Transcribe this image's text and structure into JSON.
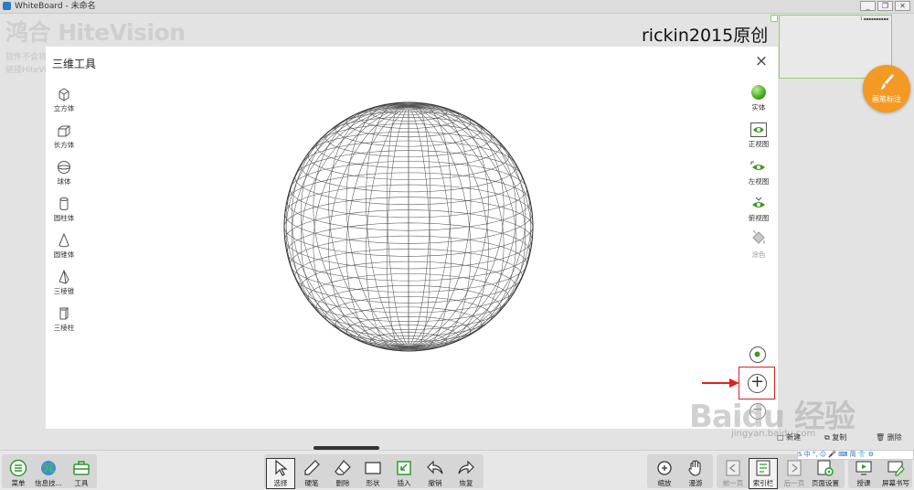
{
  "window": {
    "app_name": "WhiteBoard",
    "title": "WhiteBoard - 未命名",
    "buttons": [
      "_",
      "❐",
      "✕"
    ]
  },
  "brand": {
    "logo_text": "鸿合 HiteVision",
    "lines": [
      "软件不会将",
      "链接HiteVi"
    ]
  },
  "watermark_text": "rickin2015原创",
  "thumbnail": {
    "label": "1 ▪▪▪▪▪▪▪▪▪▪"
  },
  "pen_button": {
    "label": "画笔标注"
  },
  "dialog": {
    "title": "三维工具",
    "close": "×",
    "shapes": [
      {
        "label": "立方体",
        "icon": "cube-icon"
      },
      {
        "label": "长方体",
        "icon": "cuboid-icon"
      },
      {
        "label": "球体",
        "icon": "sphere-icon"
      },
      {
        "label": "圆柱体",
        "icon": "cylinder-icon"
      },
      {
        "label": "圆锥体",
        "icon": "cone-icon"
      },
      {
        "label": "三棱锥",
        "icon": "triangular-pyramid-icon"
      },
      {
        "label": "三棱柱",
        "icon": "triangular-prism-icon"
      }
    ],
    "views": [
      {
        "label": "实体",
        "icon": "solid-ball-icon",
        "enabled": true
      },
      {
        "label": "正视图",
        "icon": "front-view-eye-icon",
        "enabled": true
      },
      {
        "label": "左视图",
        "icon": "left-view-eye-icon",
        "enabled": true
      },
      {
        "label": "俯视图",
        "icon": "top-view-eye-icon",
        "enabled": true
      },
      {
        "label": "涂色",
        "icon": "paint-bucket-icon",
        "enabled": false
      }
    ],
    "zoom_plus": "+",
    "zoom_minus": "−"
  },
  "page_tools": [
    {
      "label": "新建",
      "icon": "new-page-icon"
    },
    {
      "label": "复制",
      "icon": "copy-page-icon"
    },
    {
      "label": "删除",
      "icon": "trash-icon"
    }
  ],
  "watermark": {
    "main": "Baidu 经验",
    "sub": "jingyan.baidu.com"
  },
  "ime_bar": "S 中 °,  ☺ 🎤 ⌨ 简 👕 ⚙",
  "toolbar": {
    "left": [
      {
        "label": "菜单",
        "icon": "menu-icon"
      },
      {
        "label": "信息技...",
        "icon": "globe-icon"
      },
      {
        "label": "工具",
        "icon": "toolbox-icon"
      }
    ],
    "center": [
      {
        "label": "选择",
        "icon": "cursor-icon",
        "selected": true
      },
      {
        "label": "硬笔",
        "icon": "pen-icon"
      },
      {
        "label": "删除",
        "icon": "eraser-icon"
      },
      {
        "label": "形状",
        "icon": "rectangle-icon"
      },
      {
        "label": "插入",
        "icon": "insert-icon"
      },
      {
        "label": "撤销",
        "icon": "undo-icon"
      },
      {
        "label": "恢复",
        "icon": "redo-icon"
      }
    ],
    "right1": [
      {
        "label": "缩放",
        "icon": "zoom-icon"
      },
      {
        "label": "漫游",
        "icon": "hand-icon"
      }
    ],
    "right2": [
      {
        "label": "前一页",
        "icon": "prev-page-icon",
        "dim": true
      },
      {
        "label": "索引栏",
        "icon": "index-icon"
      },
      {
        "label": "后一页",
        "icon": "next-page-icon",
        "dim": true
      },
      {
        "label": "页面设置",
        "icon": "page-settings-icon"
      }
    ],
    "right3": [
      {
        "label": "授课",
        "icon": "teach-icon"
      },
      {
        "label": "屏幕书写",
        "icon": "screen-write-icon"
      }
    ]
  }
}
